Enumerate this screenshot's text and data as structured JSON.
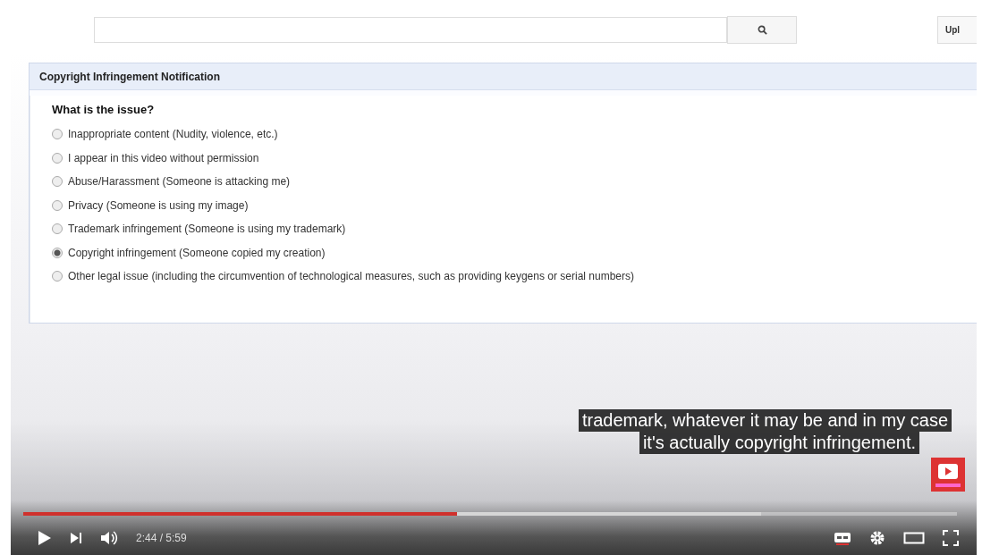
{
  "page": {
    "upload_button": "Upl",
    "panel": {
      "title": "Copyright Infringement Notification",
      "question": "What is the issue?",
      "options": [
        {
          "label": "Inappropriate content (Nudity, violence, etc.)",
          "selected": false
        },
        {
          "label": "I appear in this video without permission",
          "selected": false
        },
        {
          "label": "Abuse/Harassment (Someone is attacking me)",
          "selected": false
        },
        {
          "label": "Privacy (Someone is using my image)",
          "selected": false
        },
        {
          "label": "Trademark infringement (Someone is using my trademark)",
          "selected": false
        },
        {
          "label": "Copyright infringement (Someone copied my creation)",
          "selected": true
        },
        {
          "label": "Other legal issue (including the circumvention of technological measures, such as providing keygens or serial numbers)",
          "selected": false
        }
      ]
    }
  },
  "captions": [
    "trademark, whatever it may be and in my case",
    "it's actually copyright infringement."
  ],
  "player": {
    "progress": {
      "level": 0.465
    },
    "buffered": {
      "level": 0.79
    },
    "time": "2:44 / 5:59"
  }
}
